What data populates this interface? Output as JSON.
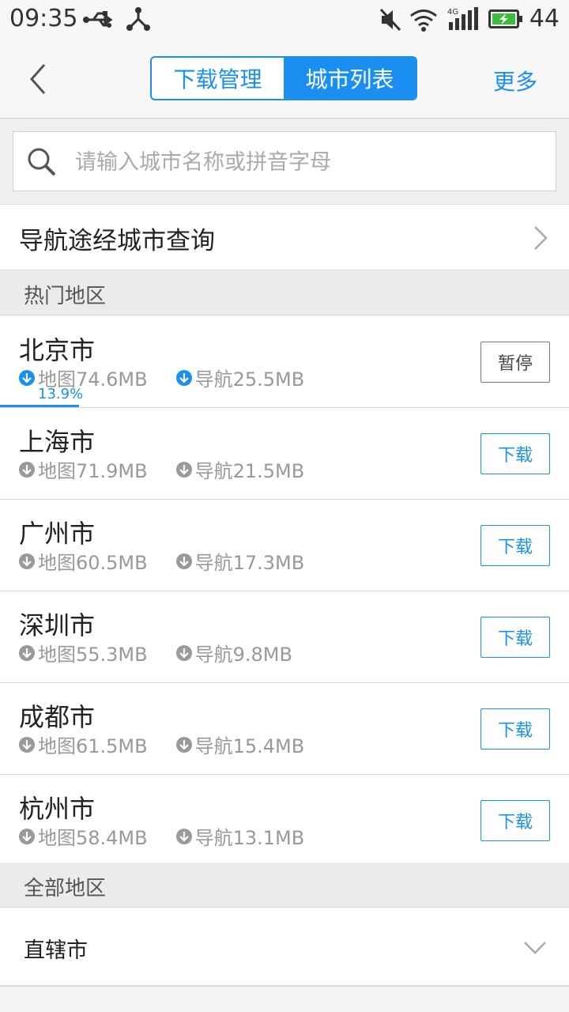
{
  "status_bar": {
    "time": "09:35",
    "battery_percent": "44",
    "icons": [
      "usb-icon",
      "share-node-icon",
      "mute-icon",
      "wifi-icon",
      "cellular-4g-icon",
      "battery-charging-icon"
    ],
    "network_label": "4G"
  },
  "nav": {
    "tabs": [
      {
        "label": "下载管理",
        "active": false
      },
      {
        "label": "城市列表",
        "active": true
      }
    ],
    "more_label": "更多"
  },
  "search": {
    "placeholder": "请输入城市名称或拼音字母",
    "value": ""
  },
  "route_query": {
    "label": "导航途经城市查询"
  },
  "hot_section": {
    "title": "热门地区",
    "cities": [
      {
        "name": "北京市",
        "map_size": "地图74.6MB",
        "nav_size": "导航25.5MB",
        "action": "暂停",
        "state": "downloading",
        "progress_label": "13.9%",
        "progress": 0.139
      },
      {
        "name": "上海市",
        "map_size": "地图71.9MB",
        "nav_size": "导航21.5MB",
        "action": "下载",
        "state": "idle"
      },
      {
        "name": "广州市",
        "map_size": "地图60.5MB",
        "nav_size": "导航17.3MB",
        "action": "下载",
        "state": "idle"
      },
      {
        "name": "深圳市",
        "map_size": "地图55.3MB",
        "nav_size": "导航9.8MB",
        "action": "下载",
        "state": "idle"
      },
      {
        "name": "成都市",
        "map_size": "地图61.5MB",
        "nav_size": "导航15.4MB",
        "action": "下载",
        "state": "idle"
      },
      {
        "name": "杭州市",
        "map_size": "地图58.4MB",
        "nav_size": "导航13.1MB",
        "action": "下载",
        "state": "idle"
      }
    ]
  },
  "all_section": {
    "title": "全部地区",
    "groups": [
      {
        "label": "直辖市",
        "expanded": false
      }
    ]
  },
  "colors": {
    "accent": "#1a8ff0",
    "text_primary": "#222222",
    "text_secondary": "#999999",
    "background": "#f4f4f4"
  }
}
